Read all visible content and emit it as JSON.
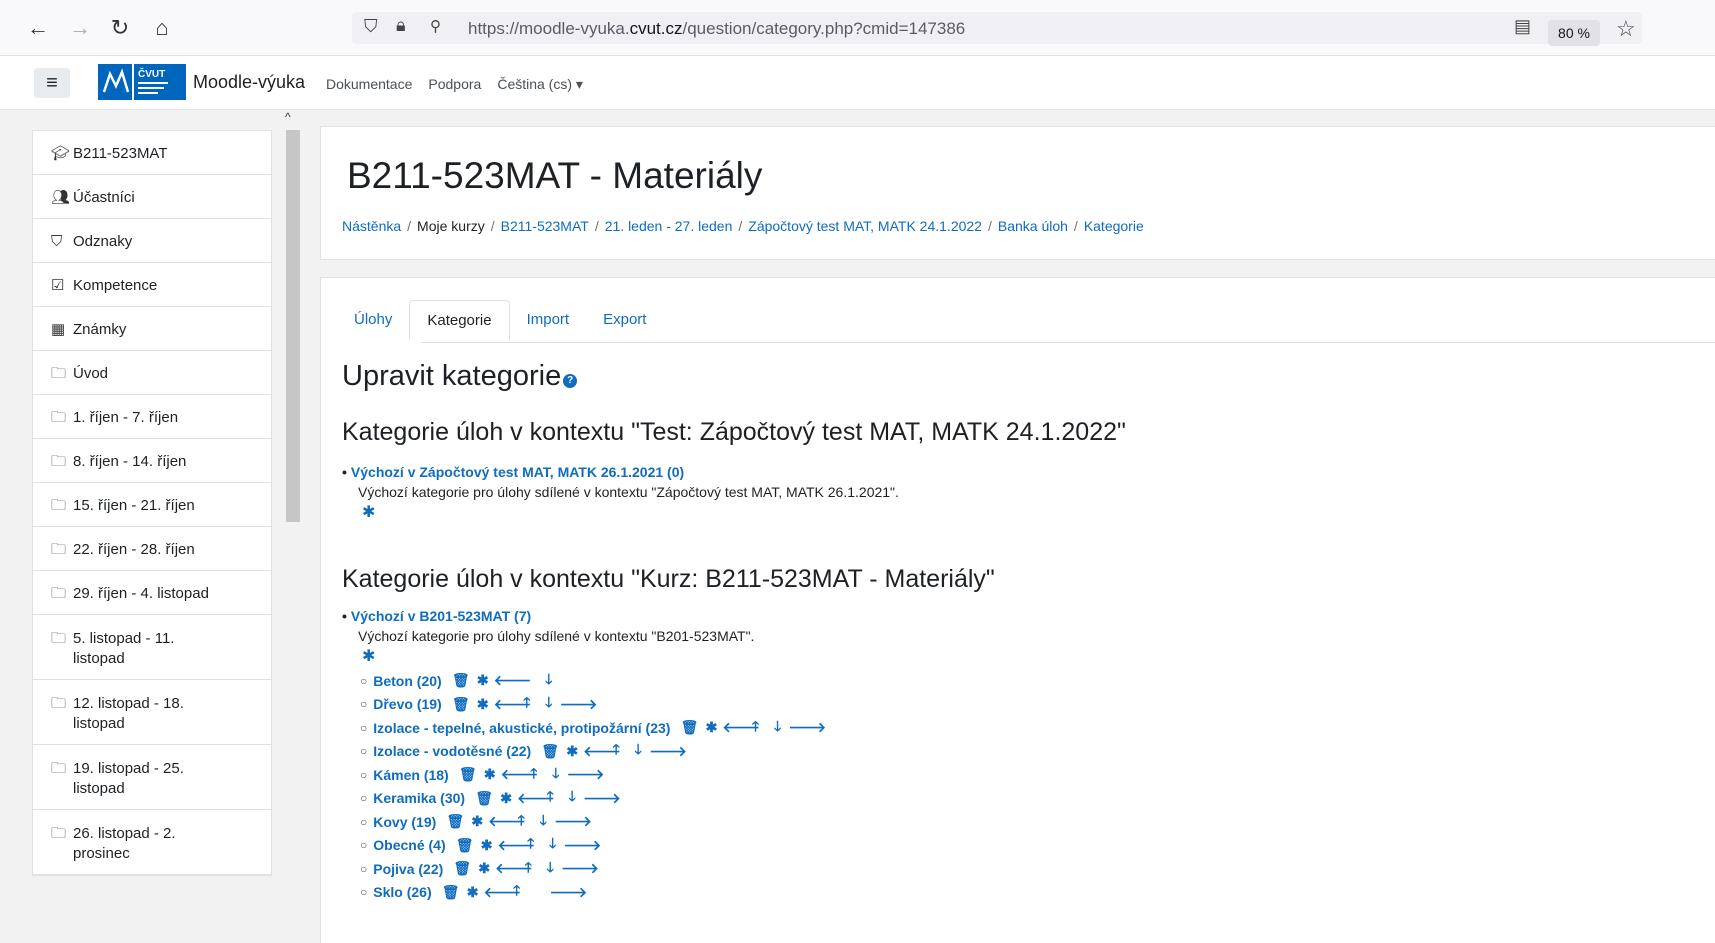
{
  "browser": {
    "url_prefix": "https://moodle-vyuka.",
    "url_domain": "cvut.cz",
    "url_path": "/question/category.php?cmid=147386",
    "zoom": "80 %"
  },
  "navbar": {
    "site_name": "Moodle-výuka",
    "links": [
      "Dokumentace",
      "Podpora",
      "Čeština (cs) ▾"
    ]
  },
  "drawer": {
    "items": [
      {
        "icon": "graduation-cap-icon",
        "label": "B211-523MAT"
      },
      {
        "icon": "users-icon",
        "label": "Účastníci"
      },
      {
        "icon": "shield-icon",
        "label": "Odznaky"
      },
      {
        "icon": "checkbox-icon",
        "label": "Kompetence"
      },
      {
        "icon": "table-icon",
        "label": "Známky"
      },
      {
        "icon": "folder-icon",
        "label": "Úvod"
      },
      {
        "icon": "folder-icon",
        "label": "1. říjen - 7. říjen"
      },
      {
        "icon": "folder-icon",
        "label": "8. říjen - 14. říjen"
      },
      {
        "icon": "folder-icon",
        "label": "15. říjen - 21. říjen"
      },
      {
        "icon": "folder-icon",
        "label": "22. říjen - 28. říjen"
      },
      {
        "icon": "folder-icon",
        "label": "29. říjen - 4. listopad"
      },
      {
        "icon": "folder-icon",
        "label": "5. listopad - 11. listopad"
      },
      {
        "icon": "folder-icon",
        "label": "12. listopad - 18. listopad"
      },
      {
        "icon": "folder-icon",
        "label": "19. listopad - 25. listopad"
      },
      {
        "icon": "folder-icon",
        "label": "26. listopad - 2. prosinec"
      }
    ]
  },
  "header": {
    "title": "B211-523MAT - Materiály",
    "breadcrumb": [
      {
        "label": "Nástěnka",
        "link": true
      },
      {
        "label": "Moje kurzy",
        "link": false
      },
      {
        "label": "B211-523MAT",
        "link": true
      },
      {
        "label": "21. leden - 27. leden",
        "link": true
      },
      {
        "label": "Zápočtový test MAT, MATK 24.1.2022",
        "link": true
      },
      {
        "label": "Banka úloh",
        "link": true
      },
      {
        "label": "Kategorie",
        "link": true
      }
    ]
  },
  "tabs": [
    "Úlohy",
    "Kategorie",
    "Import",
    "Export"
  ],
  "active_tab": "Kategorie",
  "main": {
    "section_title": "Upravit kategorie",
    "contexts": [
      {
        "title": "Kategorie úloh v kontextu \"Test: Zápočtový test MAT, MATK 24.1.2022\"",
        "top_category": "Výchozí v Zápočtový test MAT, MATK 26.1.2021 (0)",
        "description": "Výchozí kategorie pro úlohy sdílené v kontextu \"Zápočtový test MAT, MATK 26.1.2021\".",
        "subcategories": []
      },
      {
        "title": "Kategorie úloh v kontextu \"Kurz: B211-523MAT - Materiály\"",
        "top_category": "Výchozí v B201-523MAT (7)",
        "description": "Výchozí kategorie pro úlohy sdílené v kontextu \"B201-523MAT\".",
        "subcategories": [
          {
            "label": "Beton (20)",
            "up": false,
            "down": true,
            "right": false
          },
          {
            "label": "Dřevo (19)",
            "up": true,
            "down": true,
            "right": true
          },
          {
            "label": "Izolace - tepelné, akustické, protipožární (23)",
            "up": true,
            "down": true,
            "right": true
          },
          {
            "label": "Izolace - vodotěsné (22)",
            "up": true,
            "down": true,
            "right": true
          },
          {
            "label": "Kámen (18)",
            "up": true,
            "down": true,
            "right": true
          },
          {
            "label": "Keramika (30)",
            "up": true,
            "down": true,
            "right": true
          },
          {
            "label": "Kovy (19)",
            "up": true,
            "down": true,
            "right": true
          },
          {
            "label": "Obecné (4)",
            "up": true,
            "down": true,
            "right": true
          },
          {
            "label": "Pojiva (22)",
            "up": true,
            "down": true,
            "right": true
          },
          {
            "label": "Sklo (26)",
            "up": true,
            "down": false,
            "right": true
          }
        ]
      }
    ]
  },
  "colors": {
    "link": "#0f6cbf",
    "text": "#1d2125",
    "background": "#f2f2f2"
  }
}
